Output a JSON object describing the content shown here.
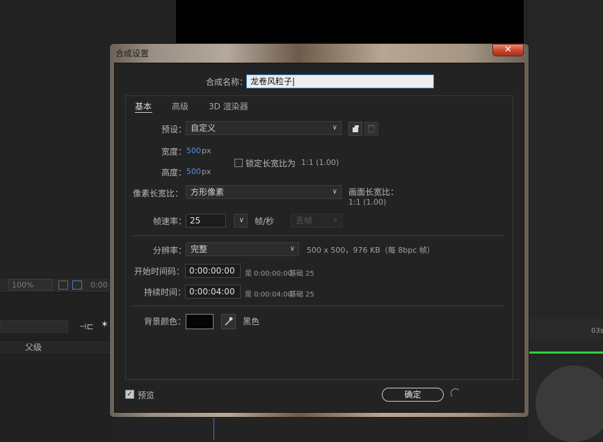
{
  "background_app": {
    "zoom_value": "100%",
    "timecode_partial": "0:00",
    "layer_column_header": "父级",
    "time_ruler_label": "03s"
  },
  "dialog": {
    "title": "合成设置",
    "close_glyph": "✕",
    "name_label": "合成名称：",
    "name_value": "龙卷风粒子",
    "tabs": [
      "基本",
      "高级",
      "3D 渲染器"
    ],
    "active_tab": "基本",
    "preset": {
      "label": "预设：",
      "value": "自定义"
    },
    "width": {
      "label": "宽度：",
      "value": "500",
      "unit": "px"
    },
    "height": {
      "label": "高度：",
      "value": "500",
      "unit": "px"
    },
    "lock_aspect": {
      "label": "锁定长宽比为",
      "ratio": "1:1 (1.00)",
      "checked": false
    },
    "pixel_aspect": {
      "label": "像素长宽比：",
      "value": "方形像素"
    },
    "frame_aspect": {
      "label": "画面长宽比：",
      "value": "1:1 (1.00)"
    },
    "frame_rate": {
      "label": "帧速率：",
      "value": "25",
      "unit": "帧/秒",
      "drop_frame": "丢帧"
    },
    "resolution": {
      "label": "分辨率：",
      "value": "完整",
      "info": "500 x 500，976 KB（每 8bpc 帧）"
    },
    "start_timecode": {
      "label": "开始时间码：",
      "value": "0:00:00:00",
      "equals": "是 0:00:00:00",
      "base": "基础 25"
    },
    "duration": {
      "label": "持续时间：",
      "value": "0:00:04:00",
      "equals": "是 0:00:04:00",
      "base": "基础 25"
    },
    "bg_color": {
      "label": "背景颜色：",
      "name": "黑色",
      "hex": "#050505"
    },
    "preview": {
      "label": "预览",
      "checked": true
    },
    "ok_label": "确定"
  },
  "colors": {
    "accent_blue": "#4b94e6",
    "close_red": "#c9452d",
    "timeline_green": "#2fd23a"
  },
  "icons": [
    "close-icon",
    "chevron-down-icon",
    "new-preset-icon",
    "trash-icon",
    "eyedropper-icon",
    "checkbox-icon",
    "spinner-icon"
  ]
}
